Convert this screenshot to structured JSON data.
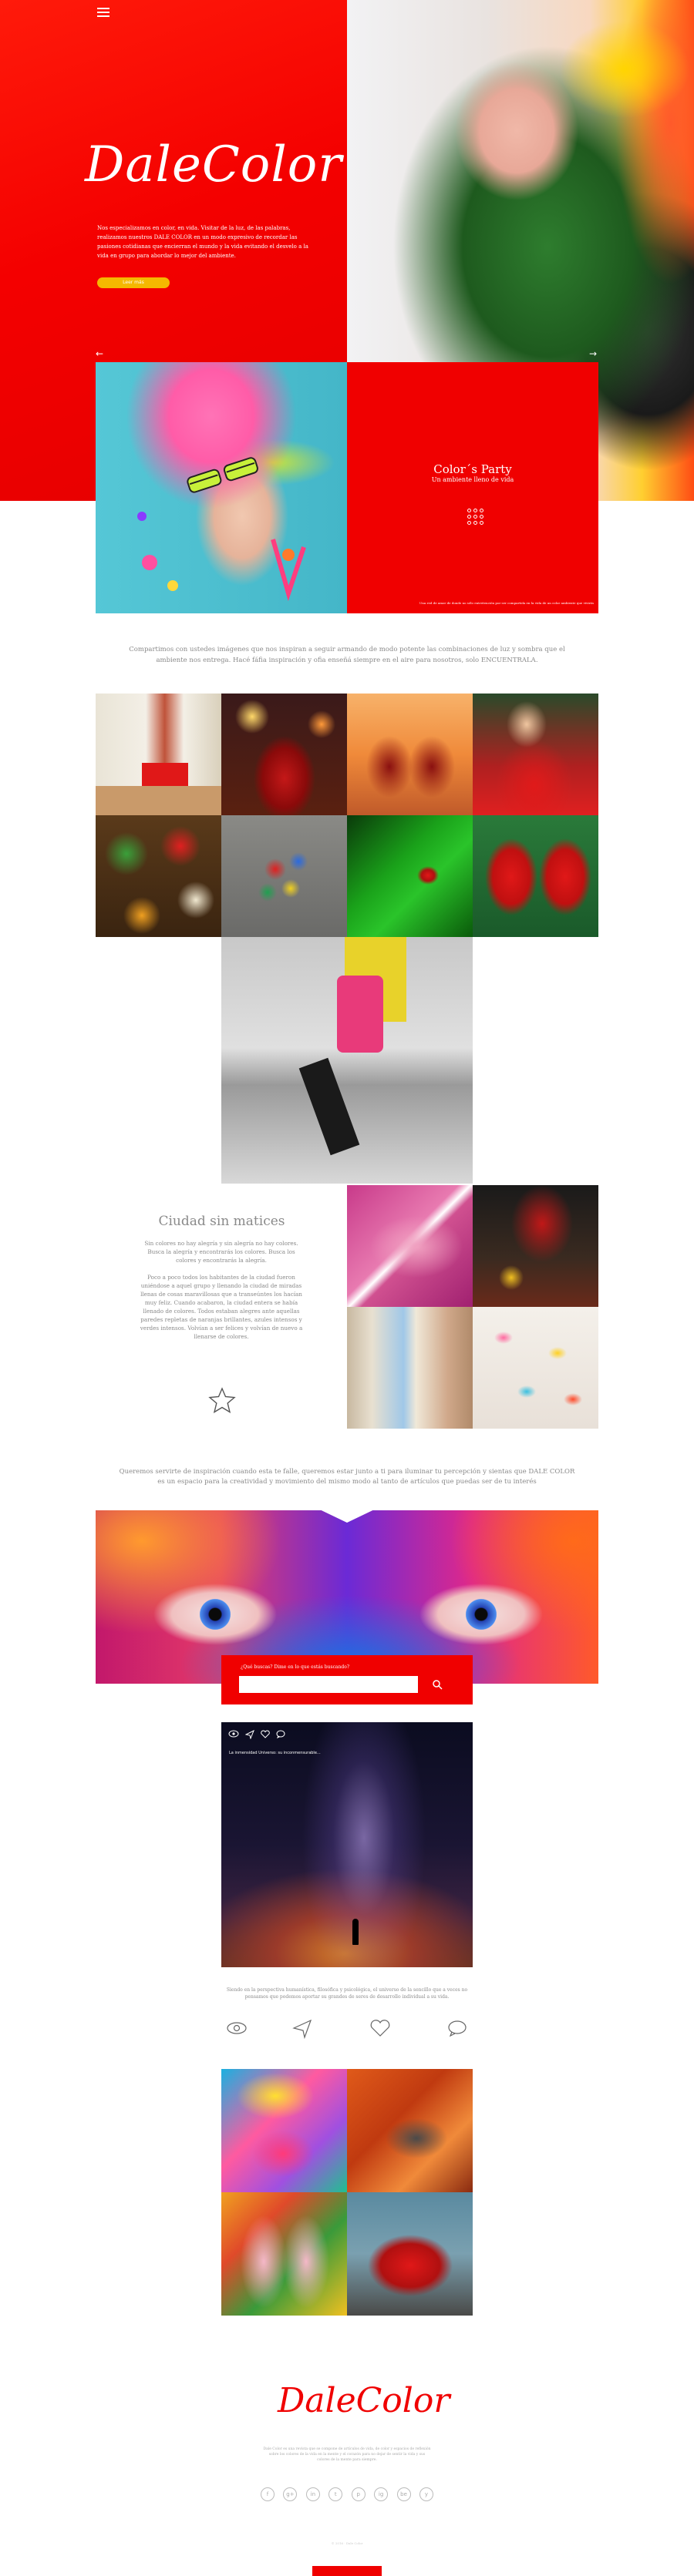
{
  "hero": {
    "logo": "DaleColor",
    "text": "Nos especializamos en color, en vida. Visitar de la luz, de las palabras, realizamos nuestros DALE COLOR en un modo expresivo de recordar las pasiones cotidianas que encierran el mundo y la vida evitando el desvelo a la vida en grupo para abordar lo mejor del ambiente.",
    "button": "Leer más"
  },
  "party": {
    "title": "Color´s Party",
    "subtitle": "Un ambiente lleno de vida",
    "footer": "Una red de amor de donde no sólo entretención por ser compartida en la vida de un color ambiente que vivirás"
  },
  "intro": "Compartimos con ustedes imágenes que nos inspiran a seguir armando de modo potente las combinaciones de luz y sombra que el ambiente nos entrega. Hacé fáfia inspiración y ofia enseñá siempre en el aire para nosotros, solo ENCUENTRALA.",
  "ciudad": {
    "title": "Ciudad sin matices",
    "p1": "Sin colores no hay alegría y sin alegría no hay colores. Busca la alegría y encontrarás los colores. Busca los colores y encontrarás la alegría.",
    "p2": "Poco a poco todos los habitantes de la ciudad fueron uniéndose a aquel grupo y llenando la ciudad de miradas llenas de cosas maravillosas que a transeúntes los hacían muy feliz. Cuando acabaron, la ciudad entera se había llenado de colores. Todos estaban alegres ante aquellas paredes repletas de naranjas brillantes, azules intensos y verdes intensos. Volvían a ser felices y volvían de nuevo a llenarse de colores."
  },
  "quote": "Queremos servirte de inspiración cuando esta te falle, queremos estar junto a ti para iluminar tu percepción y sientas que DALE COLOR es un espacio para la creatividad y movimiento del mismo modo al tanto de artículos que puedas ser de tu interés",
  "search": {
    "question": "¿Qué buscas? Dime en lo que estás buscando?",
    "placeholder": ""
  },
  "galaxy": {
    "caption": "La inmensidad Universo: su inconmensurable...",
    "text": "Siendo en la perspectiva humanística, filosófica y psicológica, el universo de la sencillo que a veces no pensamos que podemos aportar su grandes de seres de desarrollo individual a su vida."
  },
  "footer": {
    "logo": "DaleColor",
    "text": "Dale Color es una revista que se compone de artículos de vida, de color y espacios de reflexión sobre los colores de la vida en la mente y el corazón para no dejar de sentir la vida y sus colores de la mente para siempre.",
    "icons": [
      "f",
      "g+",
      "in",
      "t",
      "p",
      "ig",
      "be",
      "y"
    ],
    "copy": "© 2016 · Dale Color"
  },
  "icons": {
    "eye": "eye-icon",
    "send": "send-icon",
    "heart": "heart-icon",
    "comment": "comment-icon"
  },
  "colors": {
    "brand_red": "#f00000",
    "button_yellow": "#f5b800",
    "text_gray": "#8a8a8a"
  }
}
